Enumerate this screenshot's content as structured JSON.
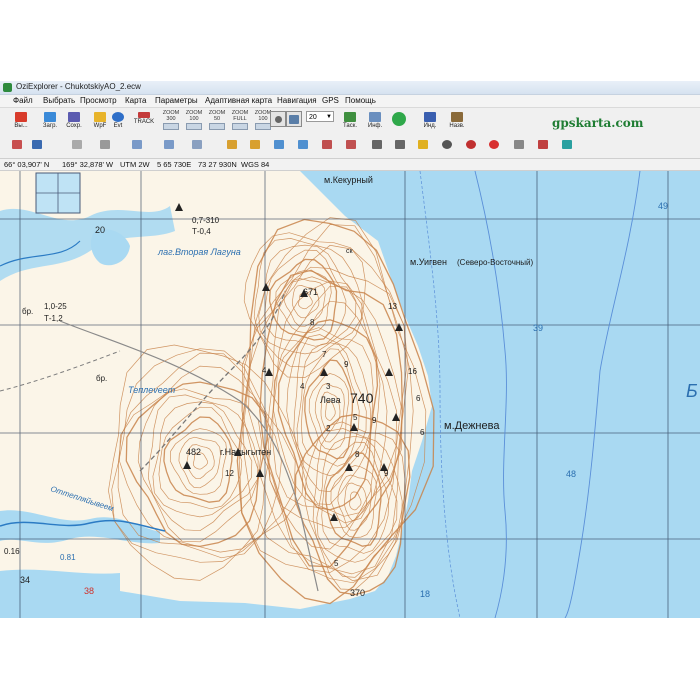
{
  "window": {
    "title": "OziExplorer - ChukotskiyAO_2.ecw"
  },
  "menu": {
    "items": [
      "Файл",
      "Выбрать",
      "Просмотр",
      "Карта",
      "Параметры",
      "Адаптивная карта",
      "Навигация",
      "GPS",
      "Помощь"
    ]
  },
  "toolbar": {
    "exit_label": "Вы...",
    "load_label": "Загр.",
    "save_label": "Сохр.",
    "wpt_label": "WpF",
    "evt_label": "Evt",
    "track_label": "TRACK",
    "zoom_buttons": [
      "ZOOM 300",
      "ZOOM 100",
      "ZOOM 50",
      "ZOOM FULL",
      "ZOOM 100"
    ],
    "zoom_value": "20",
    "task_label": "Таск.",
    "info_label": "Инф.",
    "ind_label": "Инд.",
    "name_label": "Назв."
  },
  "brand": {
    "text": "gpskarta.com",
    "color": "#1f7d33"
  },
  "status": {
    "latitude": "66° 03,907' N",
    "longitude": "169° 32,878' W",
    "utm": "UTM  2W",
    "easting": "5 65 730E",
    "northing": "73 27 930N",
    "datum": "WGS 84"
  },
  "map": {
    "water_color": "#a9d9f2",
    "land_color": "#fbf5e8",
    "contour_color": "#c8844b",
    "labels": {
      "cape_kekurny": "м.Кекурный",
      "cape_uigven": "м.Уигвен",
      "uigven_note": "(Северо-Восточный)",
      "cape_dezhneva": "м.Дежнева",
      "mount_napygyten": "г.Напыгытен",
      "height_482": "482",
      "height_671": "671",
      "height_740": "740",
      "leva": "Лева",
      "lagoon": "лаг.Вторая Лагуна",
      "tepleveem": "Теплеveem",
      "ottepleveem": "Оттепляйывеем",
      "br_left": "бр.",
      "br_note_top": "1,0-25",
      "br_note_bottom": "Т-1,2",
      "br_center": "бр.",
      "ford_top": "0,7-310",
      "ford_bottom": "Т-0,4",
      "sk": "ск",
      "d20": "20",
      "d38": "38",
      "d34": "34",
      "d370": "370",
      "d18": "18",
      "d48": "48",
      "d39": "39",
      "d49": "49",
      "d081": "0.81",
      "d016": "0.16",
      "big_b": "Б",
      "spot_numbers": [
        "5",
        "8",
        "9",
        "7",
        "4",
        "3",
        "6",
        "12",
        "4",
        "9",
        "5",
        "2",
        "9",
        "8",
        "13",
        "16",
        "6"
      ]
    }
  }
}
